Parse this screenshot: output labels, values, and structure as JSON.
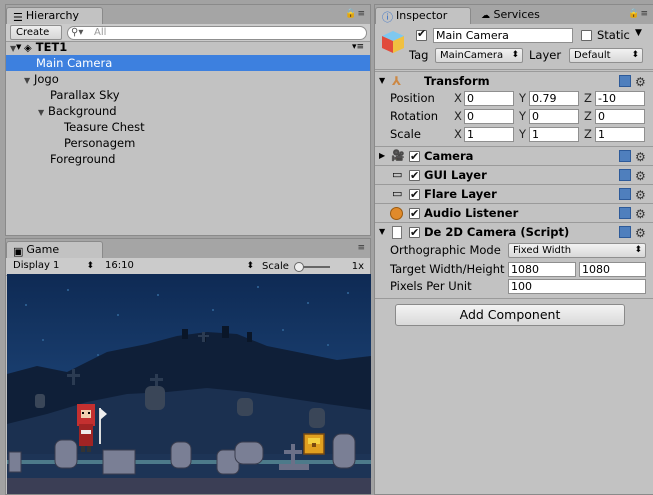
{
  "hierarchy": {
    "tab_label": "Hierarchy",
    "create_label": "Create",
    "search_placeholder": "All",
    "scene_name": "TET1",
    "items": [
      {
        "label": "Main Camera"
      },
      {
        "label": "Jogo"
      },
      {
        "label": "Parallax Sky"
      },
      {
        "label": "Background"
      },
      {
        "label": "Teasure Chest"
      },
      {
        "label": "Personagem"
      },
      {
        "label": "Foreground"
      }
    ]
  },
  "game": {
    "tab_label": "Game",
    "display": "Display 1",
    "aspect": "16:10",
    "scale_label": "Scale",
    "scale_value": "1x",
    "scale_level": 0.1
  },
  "inspector": {
    "tabs": [
      "Inspector",
      "Services"
    ],
    "object_name": "Main Camera",
    "static_label": "Static",
    "tag_label": "Tag",
    "tag_value": "MainCamera",
    "layer_label": "Layer",
    "layer_value": "Default",
    "transform": {
      "title": "Transform",
      "rows": [
        {
          "label": "Position",
          "x": "0",
          "y": "0.79",
          "z": "-10"
        },
        {
          "label": "Rotation",
          "x": "0",
          "y": "0",
          "z": "0"
        },
        {
          "label": "Scale",
          "x": "1",
          "y": "1",
          "z": "1"
        }
      ],
      "axis": [
        "X",
        "Y",
        "Z"
      ]
    },
    "components": [
      {
        "title": "Camera"
      },
      {
        "title": "GUI Layer"
      },
      {
        "title": "Flare Layer"
      },
      {
        "title": "Audio Listener"
      },
      {
        "title": "De 2D Camera (Script)"
      }
    ],
    "script_fields": {
      "ortho_label": "Orthographic Mode",
      "ortho_value": "Fixed Width",
      "target_label": "Target Width/Height",
      "target_w": "1080",
      "target_h": "1080",
      "ppu_label": "Pixels Per Unit",
      "ppu_value": "100"
    },
    "add_component": "Add Component"
  }
}
